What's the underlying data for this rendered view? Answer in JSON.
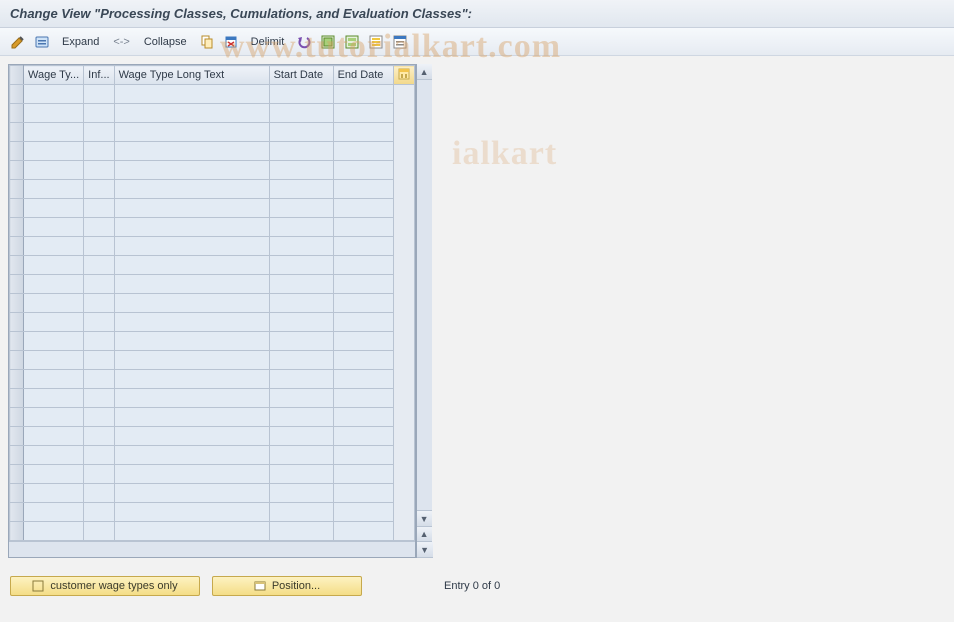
{
  "title": "Change View \"Processing Classes, Cumulations, and Evaluation Classes\":",
  "toolbar": {
    "expand_label": "Expand",
    "arrow_label": "<->",
    "collapse_label": "Collapse",
    "delimit_label": "Delimit"
  },
  "columns": {
    "wage_type": "Wage Ty...",
    "inf": "Inf...",
    "long_text": "Wage Type Long Text",
    "start_date": "Start Date",
    "end_date": "End Date"
  },
  "rows_count": 24,
  "footer": {
    "customer_btn": "customer wage types only",
    "position_btn": "Position...",
    "entry_text": "Entry 0 of 0"
  },
  "watermark": "www.tutorialkart.com",
  "watermark2": "ialkart"
}
